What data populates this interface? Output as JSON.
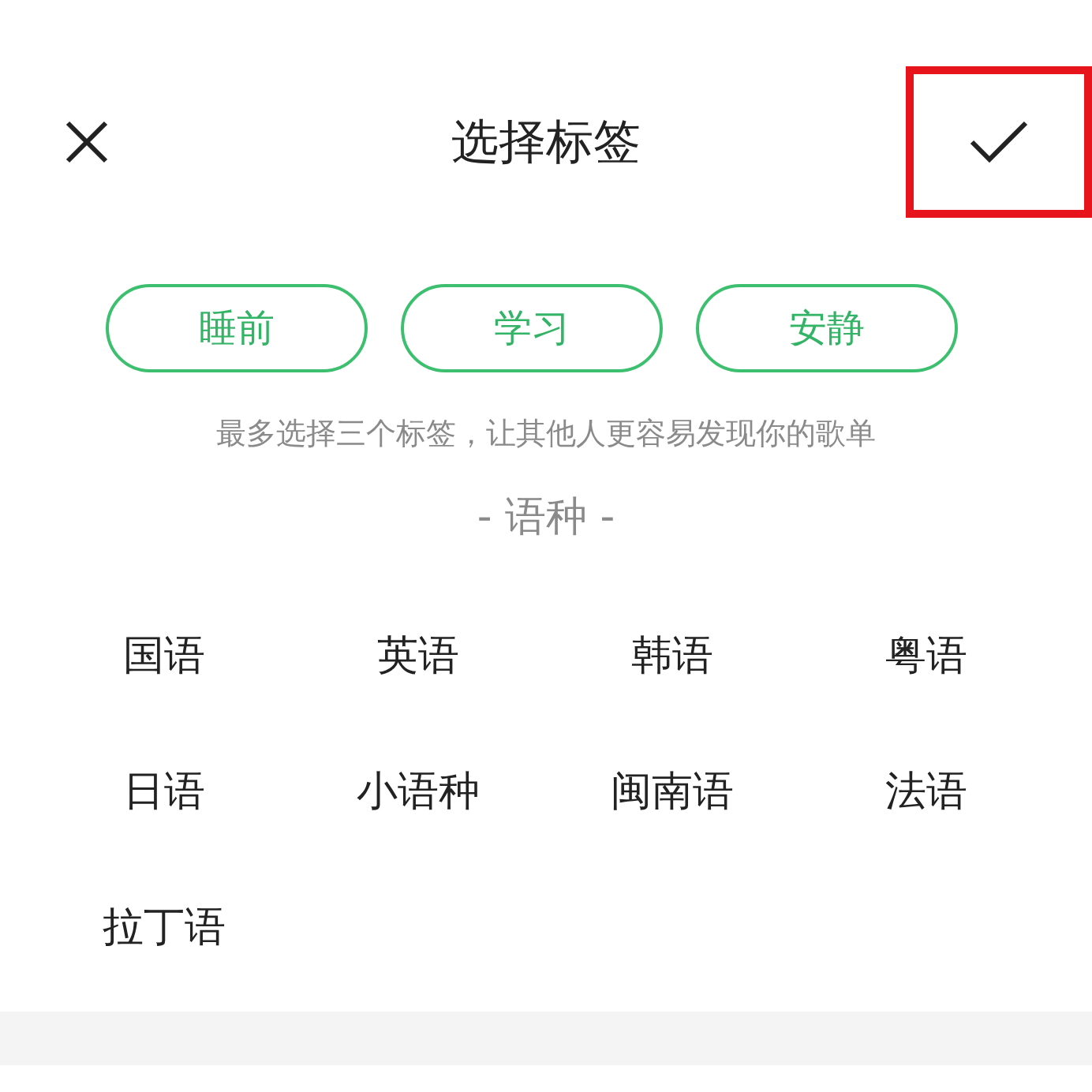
{
  "header": {
    "title": "选择标签",
    "confirm_highlighted": true
  },
  "selected_tags": [
    {
      "label": "睡前"
    },
    {
      "label": "学习"
    },
    {
      "label": "安静"
    }
  ],
  "hint": "最多选择三个标签，让其他人更容易发现你的歌单",
  "section": {
    "title": "- 语种 -",
    "items": [
      {
        "label": "国语"
      },
      {
        "label": "英语"
      },
      {
        "label": "韩语"
      },
      {
        "label": "粤语"
      },
      {
        "label": "日语"
      },
      {
        "label": "小语种"
      },
      {
        "label": "闽南语"
      },
      {
        "label": "法语"
      },
      {
        "label": "拉丁语"
      }
    ]
  }
}
